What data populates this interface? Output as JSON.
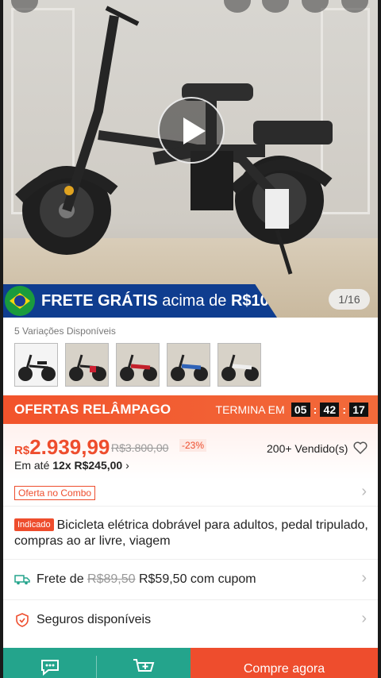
{
  "hero": {
    "banner_flag": "brazil-flag-icon",
    "banner_text_bold": "FRETE GRÁTIS",
    "banner_text_mid": " acima de ",
    "banner_text_amount": "R$10",
    "image_counter": "1/16"
  },
  "variations": {
    "label": "5 Variações Disponíveis",
    "thumbs": [
      "black-bike",
      "black-bike-red",
      "red-bike",
      "blue-bike",
      "white-bike"
    ]
  },
  "flash_sale": {
    "title": "OFERTAS RELÂMPAGO",
    "ends_label": "TERMINA EM",
    "hours": "05",
    "minutes": "42",
    "seconds": "17"
  },
  "price": {
    "currency": "R$",
    "value": "2.939,99",
    "old_price": "R$3.800,00",
    "discount": "-23%",
    "sold": "200+ Vendido(s)",
    "installment_prefix": "Em até ",
    "installment_bold": "12x R$245,00",
    "installment_chevron": "›"
  },
  "combo": {
    "label": "Oferta no Combo"
  },
  "product": {
    "badge": "Indicado",
    "title": "Bicicleta elétrica dobrável para adultos, pedal tripulado, compras ao ar livre, viagem"
  },
  "shipping": {
    "prefix": "Frete de ",
    "old": "R$89,50",
    "new": " R$59,50 com cupom"
  },
  "insurance": {
    "label": "Seguros disponíveis"
  },
  "bottom_bar": {
    "buy_now": "Compre agora"
  },
  "colors": {
    "accent": "#ee4d2d",
    "teal": "#24a48c",
    "banner_blue": "#0f3d8f"
  }
}
